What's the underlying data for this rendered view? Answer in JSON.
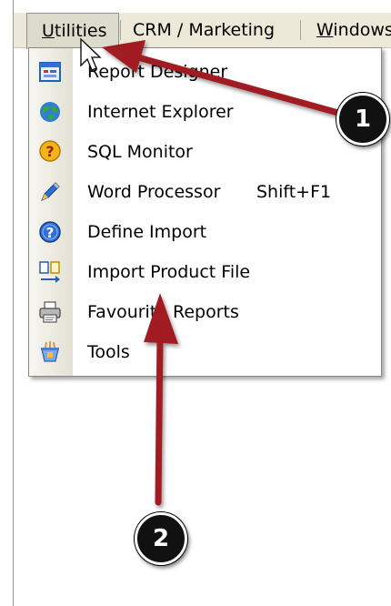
{
  "menubar": {
    "items": [
      {
        "label": "Utilities",
        "accel": "U",
        "rest": "tilities"
      },
      {
        "label": "CRM / Marketing"
      },
      {
        "label": "Windows",
        "accel": "W",
        "rest": "indows"
      }
    ]
  },
  "utilities_menu": {
    "items": [
      {
        "label": "Report Designer",
        "icon": "report-designer-icon"
      },
      {
        "label": "Internet Explorer",
        "icon": "internet-explorer-globe-icon"
      },
      {
        "label": "SQL Monitor",
        "icon": "sql-monitor-question-icon"
      },
      {
        "label": "Word Processor",
        "shortcut": "Shift+F1",
        "icon": "pen-icon"
      },
      {
        "label": "Define Import",
        "icon": "help-circle-icon"
      },
      {
        "label": "Import Product File",
        "icon": "import-file-icon"
      },
      {
        "label": "Favourite Reports",
        "icon": "printer-icon"
      },
      {
        "label": "Tools",
        "icon": "tools-icon"
      }
    ]
  },
  "callouts": [
    {
      "number": "1"
    },
    {
      "number": "2"
    }
  ],
  "colors": {
    "menubar_bg": "#ece9d8",
    "arrow": "#a01c20",
    "badge_bg": "#111111"
  }
}
